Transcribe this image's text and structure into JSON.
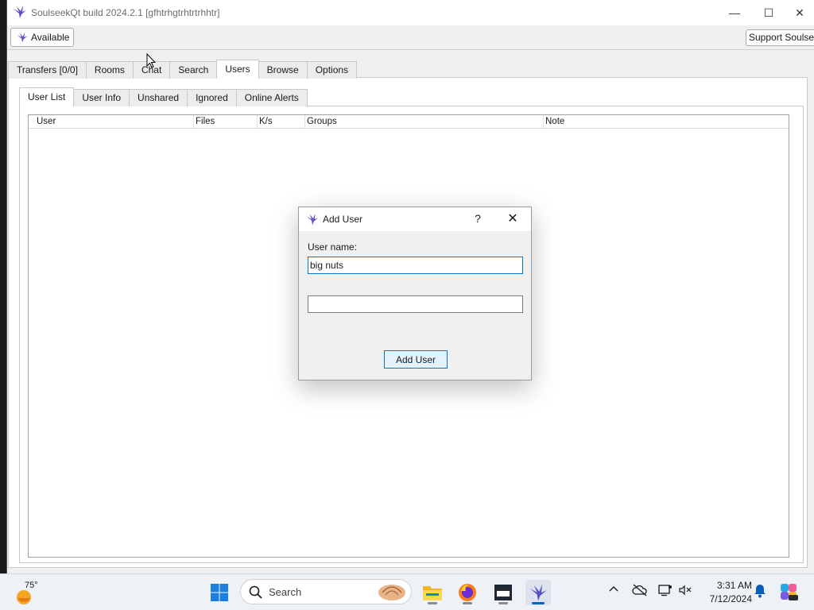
{
  "window": {
    "title": "SoulseekQt build 2024.2.1 [gfhtrhgtrhtrtrhhtr]",
    "minimize_glyph": "—",
    "maximize_glyph": "☐",
    "close_glyph": "✕"
  },
  "toolbar": {
    "status_label": "Available",
    "support_label": "Support Soulseek"
  },
  "main_tabs": [
    "Transfers [0/0]",
    "Rooms",
    "Chat",
    "Search",
    "Users",
    "Browse",
    "Options"
  ],
  "main_tabs_active": "Users",
  "users_tabs": [
    "User List",
    "User Info",
    "Unshared",
    "Ignored",
    "Online Alerts"
  ],
  "users_tabs_active": "User List",
  "user_table": {
    "columns": [
      "User",
      "Files",
      "K/s",
      "Groups",
      "Note"
    ],
    "rows": []
  },
  "dialog": {
    "title": "Add User",
    "help_glyph": "?",
    "close_glyph": "✕",
    "username_label": "User name:",
    "username_value": "big nuts",
    "second_value": "",
    "submit_label": "Add User"
  },
  "taskbar": {
    "weather_temp": "75°",
    "search_label": "Search",
    "clock_time": "3:31 AM",
    "clock_date": "7/12/2024",
    "pinned_icons": [
      "windows-start-icon",
      "file-explorer-icon",
      "firefox-icon",
      "media-app-icon",
      "soulseek-icon"
    ],
    "tray_icons": [
      "chevron-up-icon",
      "cloud-offline-icon",
      "display-icon",
      "network-sound-icon",
      "notification-bell-icon",
      "copilot-icon"
    ]
  },
  "colors": {
    "accent": "#0078d7",
    "window_bg": "#f0f0f0",
    "taskbar_bg": "#eef1f6",
    "soulseek_purple": "#6a5acd"
  }
}
